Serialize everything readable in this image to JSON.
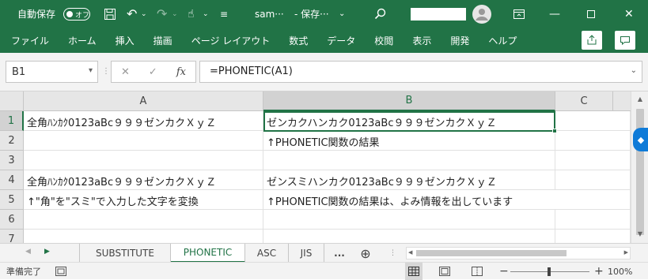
{
  "titlebar": {
    "autosave_label": "自動保存",
    "autosave_state": "オフ",
    "filename": "sam···",
    "save_status": "- 保存···",
    "caret": "⌄"
  },
  "ribbon": {
    "tabs": [
      "ファイル",
      "ホーム",
      "挿入",
      "描画",
      "ページ レイアウト",
      "数式",
      "データ",
      "校閲",
      "表示",
      "開発",
      "ヘルプ"
    ]
  },
  "formula_bar": {
    "name_box": "B1",
    "formula": "=PHONETIC(A1)",
    "cancel": "✕",
    "enter": "✓",
    "fx": "fx"
  },
  "sheet": {
    "columns": [
      "A",
      "B",
      "C"
    ],
    "rows": [
      "1",
      "2",
      "3",
      "4",
      "5",
      "6",
      "7"
    ],
    "cells": {
      "A1": "全角ﾊﾝｶｸ0123aBc９９９ゼンカクＸｙＺ",
      "B1": "ゼンカクハンカク0123aBc９９９ゼンカクＸｙＺ",
      "B2": "↑PHONETIC関数の結果",
      "A4": "全角ﾊﾝｶｸ0123aBc９９９ゼンカクＸｙＺ",
      "B4": "ゼンスミハンカク0123aBc９９９ゼンカクＸｙＺ",
      "A5": "↑\"角\"を\"スミ\"で入力した文字を変換",
      "B5": "↑PHONETIC関数の結果は、よみ情報を出しています"
    }
  },
  "sheet_tabs": {
    "tabs": [
      "SUBSTITUTE",
      "PHONETIC",
      "ASC",
      "JIS"
    ],
    "active": "PHONETIC",
    "more": "...",
    "add": "⊕"
  },
  "status_bar": {
    "ready": "準備完了",
    "zoom": "100%",
    "minus": "−",
    "plus": "+"
  },
  "colors": {
    "accent": "#217346",
    "side_button": "#0f7bd8"
  }
}
